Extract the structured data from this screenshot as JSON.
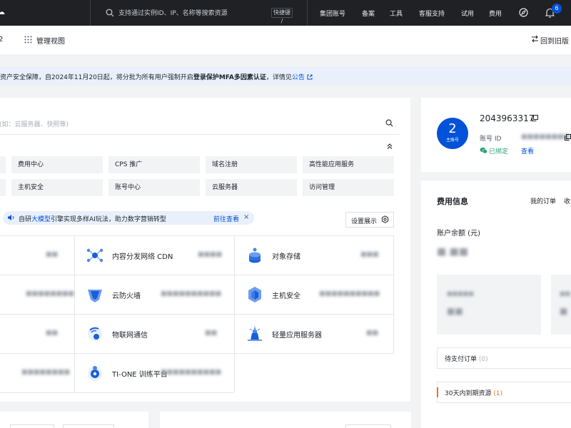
{
  "topbar": {
    "search_placeholder": "支持通过实例ID、IP、名称等搜索资源",
    "search_shortcut": "快捷键 /",
    "nav": [
      "集团账号",
      "备案",
      "工具",
      "客服支持",
      "试用",
      "费用"
    ],
    "notification_count": "6"
  },
  "toolbar": {
    "left_edge_text": "2",
    "manage_view_label": "管理视图",
    "back_to_old_label": "回到旧版"
  },
  "notice": {
    "text_before": "资产安全保障，自2024年11月20日起，将分批为所有用户强制开启",
    "text_strong": "登录保护MFA多因素认证",
    "text_after": "，详情见",
    "link": "公告"
  },
  "main": {
    "search_placeholder": "(如：云服务器、快照等)",
    "quick_links_row1": [
      "费用中心",
      "CPS 推广",
      "域名注册",
      "高性能应用服务"
    ],
    "quick_links_row2": [
      "主机安全",
      "账号中心",
      "云服务器",
      "访问管理"
    ],
    "promo": {
      "prefix": "自研",
      "highlight": "大模型",
      "suffix": "引擎实现多样AI玩法，助力数字营销转型",
      "action": "前往查看",
      "close": "×"
    },
    "settings_label": "设置展示",
    "products": [
      {
        "name": "内容分发网络 CDN",
        "icon": "cdn-icon"
      },
      {
        "name": "对象存储",
        "icon": "object-storage-icon"
      },
      {
        "name": "云防火墙",
        "icon": "cloud-firewall-icon"
      },
      {
        "name": "主机安全",
        "icon": "host-security-icon"
      },
      {
        "name": "物联网通信",
        "icon": "iot-icon"
      },
      {
        "name": "轻量应用服务器",
        "icon": "lighthouse-icon"
      },
      {
        "name": "TI-ONE 训练平台",
        "icon": "ti-one-icon"
      }
    ]
  },
  "account": {
    "avatar_number": "2",
    "avatar_caption": "主账号",
    "name": "2043963317",
    "id_label": "账号 ID",
    "wechat_status": "已绑定",
    "view_link": "查看"
  },
  "fee": {
    "title": "费用信息",
    "orders_link": "我的订单",
    "more_link": "收",
    "balance_label": "账户余额 (元)",
    "pending_orders_label": "待支付订单",
    "pending_orders_count": "(0)",
    "expiring_label": "30天内到期资源",
    "expiring_count": "(1)"
  },
  "colors": {
    "brand": "#0052d9",
    "topbar": "#1f2124",
    "notice_bg": "#e9f0fb",
    "warning": "#e37318",
    "success": "#2ba471"
  }
}
